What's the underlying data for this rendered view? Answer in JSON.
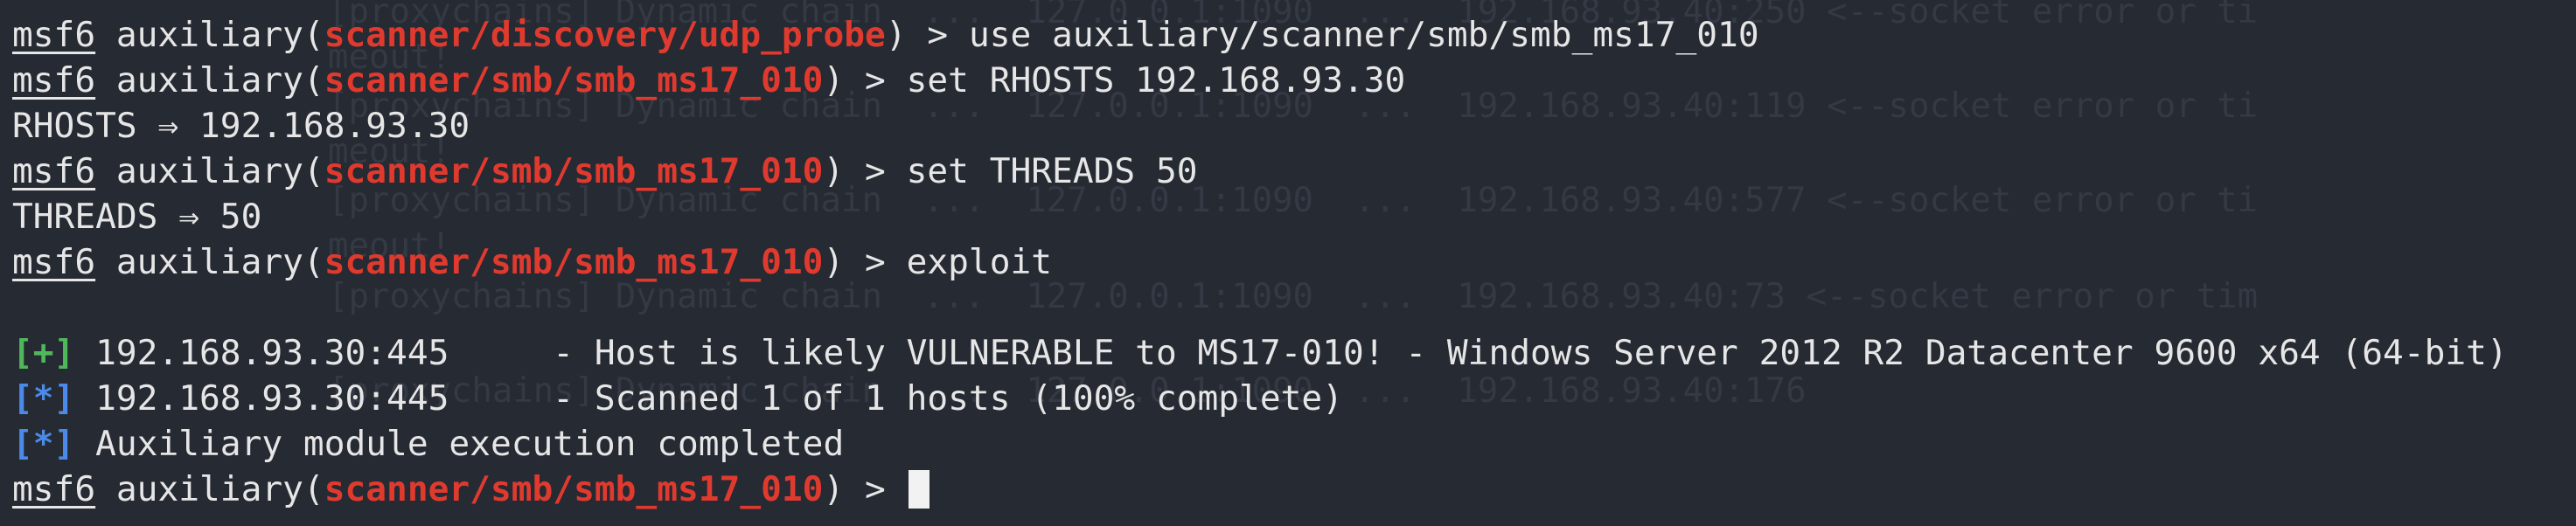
{
  "ghost": {
    "lines": [
      "[proxychains] Dynamic chain  ...  127.0.0.1:1090  ...  192.168.93.40:250 <--socket error or ti",
      "meout!",
      "[proxychains] Dynamic chain  ...  127.0.0.1:1090  ...  192.168.93.40:119 <--socket error or ti",
      "meout!",
      "[proxychains] Dynamic chain  ...  127.0.0.1:1090  ...  192.168.93.40:577 <--socket error or ti",
      "meout!",
      "[proxychains] Dynamic chain  ...  127.0.0.1:1090  ...  192.168.93.40:73 <--socket error or tim",
      "[proxychains] Dynamic chain  ...  127.0.0.1:1090  ...  192.168.93.40:176 "
    ]
  },
  "terminal": {
    "prompt_name": "msf6",
    "prompt_word": "auxiliary",
    "prompt_suffix": ") > ",
    "lines": [
      {
        "kind": "prompt",
        "module": "scanner/discovery/udp_probe",
        "command": "use auxiliary/scanner/smb/smb_ms17_010"
      },
      {
        "kind": "prompt",
        "module": "scanner/smb/smb_ms17_010",
        "command": "set RHOSTS 192.168.93.30"
      },
      {
        "kind": "output",
        "text": "RHOSTS ⇒ 192.168.93.30"
      },
      {
        "kind": "prompt",
        "module": "scanner/smb/smb_ms17_010",
        "command": "set THREADS 50"
      },
      {
        "kind": "output",
        "text": "THREADS ⇒ 50"
      },
      {
        "kind": "prompt",
        "module": "scanner/smb/smb_ms17_010",
        "command": "exploit"
      },
      {
        "kind": "blank"
      },
      {
        "kind": "status",
        "tag": "[+]",
        "tag_color": "#4fb85a",
        "text": " 192.168.93.30:445     - Host is likely VULNERABLE to MS17-010! - Windows Server 2012 R2 Datacenter 9600 x64 (64-bit)"
      },
      {
        "kind": "status",
        "tag": "[*]",
        "tag_color": "#4b8ae8",
        "text": " 192.168.93.30:445     - Scanned 1 of 1 hosts (100% complete)"
      },
      {
        "kind": "status",
        "tag": "[*]",
        "tag_color": "#4b8ae8",
        "text": " Auxiliary module execution completed"
      },
      {
        "kind": "prompt",
        "module": "scanner/smb/smb_ms17_010",
        "command": "",
        "cursor": true
      }
    ]
  },
  "colors": {
    "background": "#262a33",
    "text": "#e6e6e6",
    "module": "#e03a2f",
    "success": "#4fb85a",
    "info": "#4b8ae8"
  }
}
